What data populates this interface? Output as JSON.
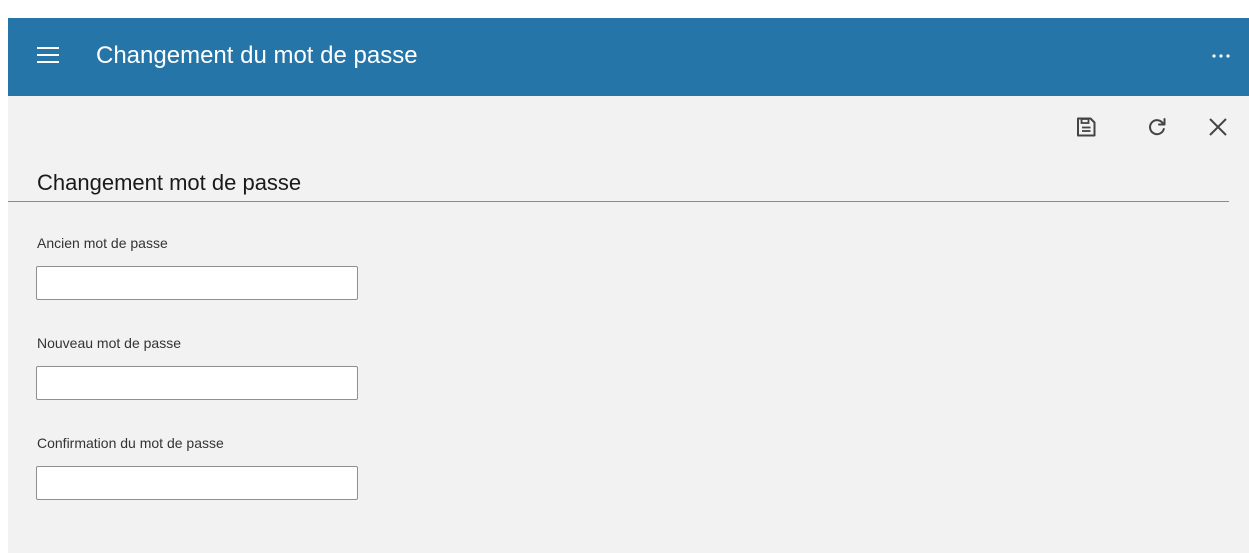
{
  "app_bar": {
    "title": "Changement du mot de passe",
    "menu_icon": "hamburger-menu-icon",
    "more_icon": "more-horizontal-icon",
    "background": "#2675a8"
  },
  "toolbar": {
    "actions": [
      {
        "name": "save",
        "icon": "save-icon"
      },
      {
        "name": "refresh",
        "icon": "refresh-icon"
      },
      {
        "name": "close",
        "icon": "close-icon"
      }
    ]
  },
  "form": {
    "section_title": "Changement mot de passe",
    "fields": [
      {
        "label": "Ancien mot de passe",
        "value": "",
        "type": "password"
      },
      {
        "label": "Nouveau mot de passe",
        "value": "",
        "type": "password"
      },
      {
        "label": "Confirmation du mot de passe",
        "value": "",
        "type": "password"
      }
    ]
  }
}
